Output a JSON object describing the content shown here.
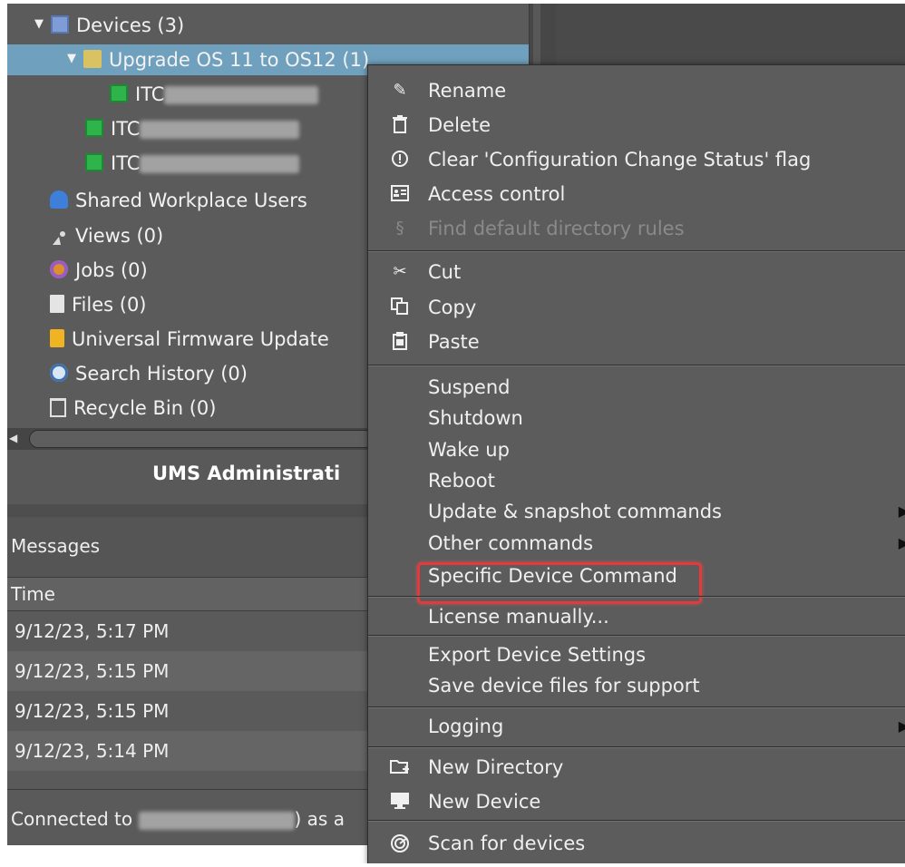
{
  "tree": {
    "devices": {
      "label": "Devices (3)",
      "icon": "monitor-icon"
    },
    "upgrade_folder": {
      "label": "Upgrade OS 11 to OS12 (1)",
      "icon": "folder-icon"
    },
    "device1": {
      "prefix": "ITC"
    },
    "device2": {
      "prefix": "ITC"
    },
    "device3": {
      "prefix": "ITC"
    },
    "items": [
      {
        "label": "Shared Workplace Users",
        "icon": "user-icon"
      },
      {
        "label": "Views (0)",
        "icon": "satellite-icon"
      },
      {
        "label": "Jobs (0)",
        "icon": "gear-icon"
      },
      {
        "label": "Files (0)",
        "icon": "file-icon"
      },
      {
        "label": "Universal Firmware Update",
        "icon": "firmware-icon"
      },
      {
        "label": "Search History (0)",
        "icon": "magnifier-icon"
      },
      {
        "label": "Recycle Bin (0)",
        "icon": "trash-icon"
      }
    ]
  },
  "ums_title": "UMS Administrati",
  "messages": {
    "title": "Messages",
    "header_time": "Time",
    "rows": [
      "9/12/23, 5:17 PM",
      "9/12/23, 5:15 PM",
      "9/12/23, 5:15 PM",
      "9/12/23, 5:14 PM"
    ]
  },
  "status": {
    "prefix": "Connected to",
    "suffix": ") as a"
  },
  "menu": {
    "rename": "Rename",
    "delete": "Delete",
    "clear_flag": "Clear 'Configuration Change Status' flag",
    "access_control": "Access control",
    "find_rules": "Find default directory rules",
    "cut": "Cut",
    "copy": "Copy",
    "paste": "Paste",
    "suspend": "Suspend",
    "shutdown": "Shutdown",
    "wake_up": "Wake up",
    "reboot": "Reboot",
    "update_snapshot": "Update & snapshot commands",
    "other_commands": "Other commands",
    "specific_device_command": "Specific Device Command",
    "license_manually": "License manually...",
    "export_settings": "Export Device Settings",
    "save_files": "Save device files for support",
    "logging": "Logging",
    "new_directory": "New Directory",
    "new_device": "New Device",
    "scan": "Scan for devices"
  },
  "colors": {
    "accent_selected": "#6fa0bd",
    "highlight_border": "#e33b3b"
  }
}
